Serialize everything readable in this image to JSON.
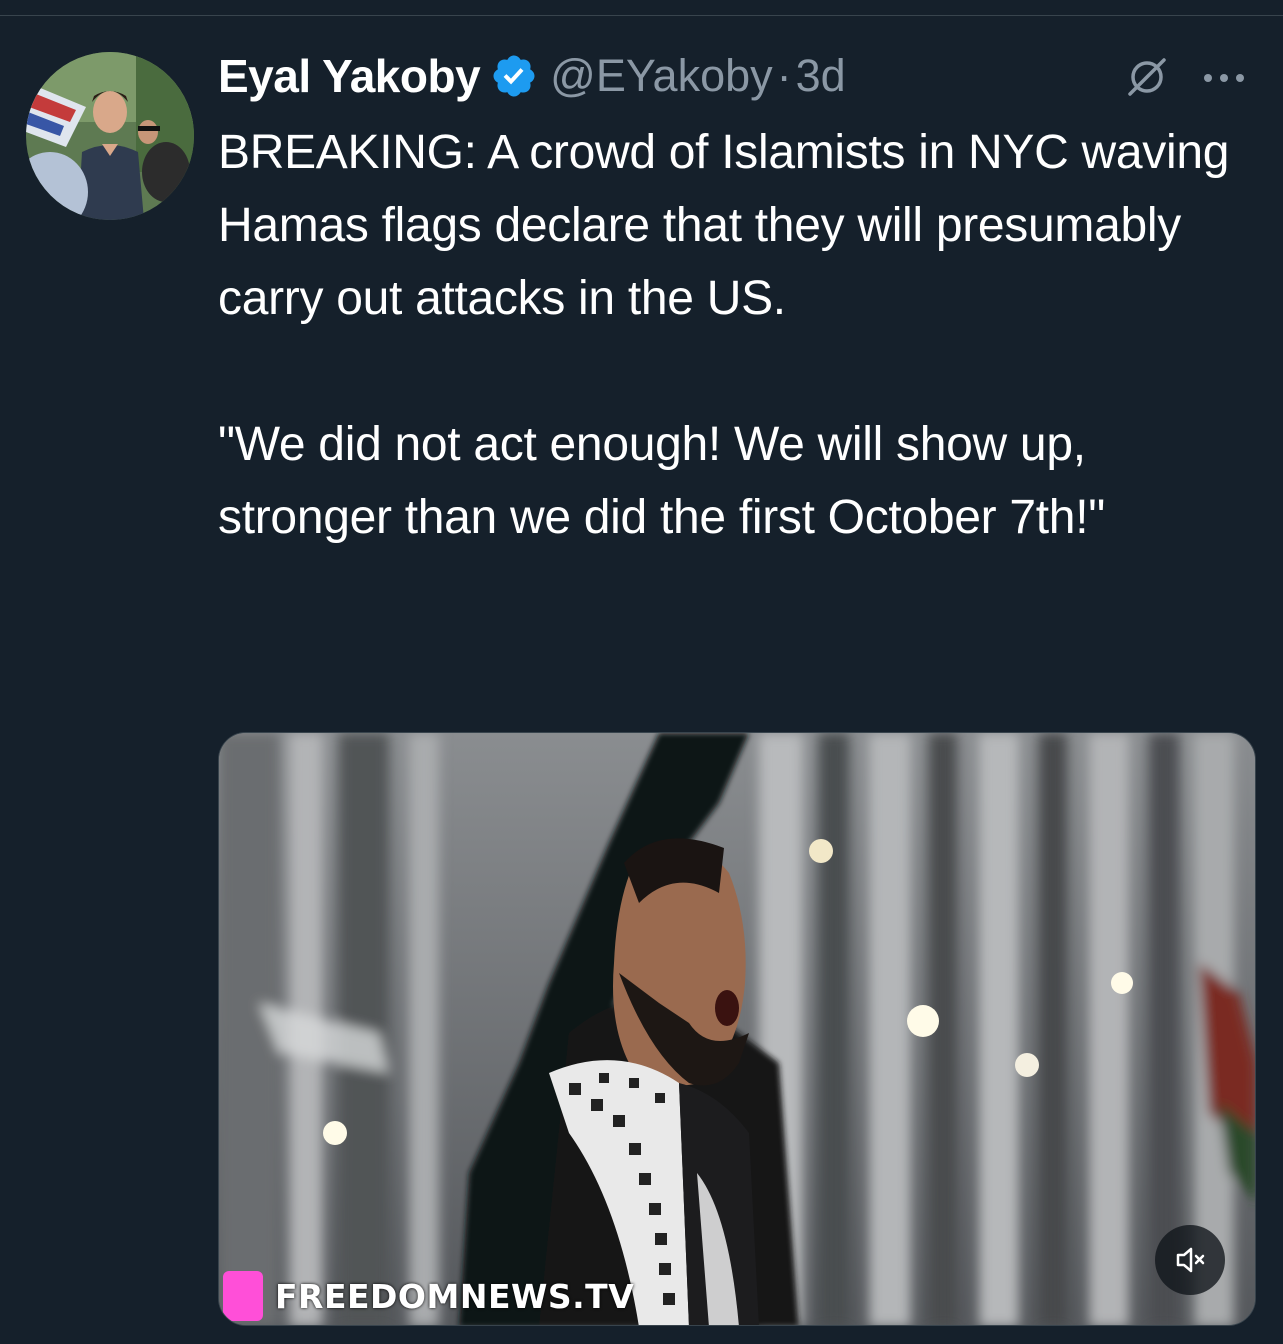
{
  "tweet": {
    "author": {
      "name": "Eyal Yakoby",
      "handle": "@EYakoby",
      "verified": true
    },
    "separator": "·",
    "time": "3d",
    "text_paragraphs": [
      "BREAKING: A crowd of Islamists in NYC waving Hamas flags declare that they will presumably carry out attacks in the US.",
      "\"We did not act enough! We will show up, stronger than we did the first October 7th!\""
    ],
    "media": {
      "type": "video",
      "watermark": "FREEDOMNEWS.TV",
      "muted": true
    }
  },
  "icons": {
    "verified": "verified-badge-icon",
    "grok": "grok-icon",
    "more": "more-icon",
    "mute": "mute-icon"
  },
  "colors": {
    "background": "#15202b",
    "text_primary": "#ffffff",
    "text_secondary": "#8b98a5",
    "verified_blue": "#1d9bf0",
    "divider": "#38444d",
    "watermark_accent": "#ff4fd8"
  }
}
